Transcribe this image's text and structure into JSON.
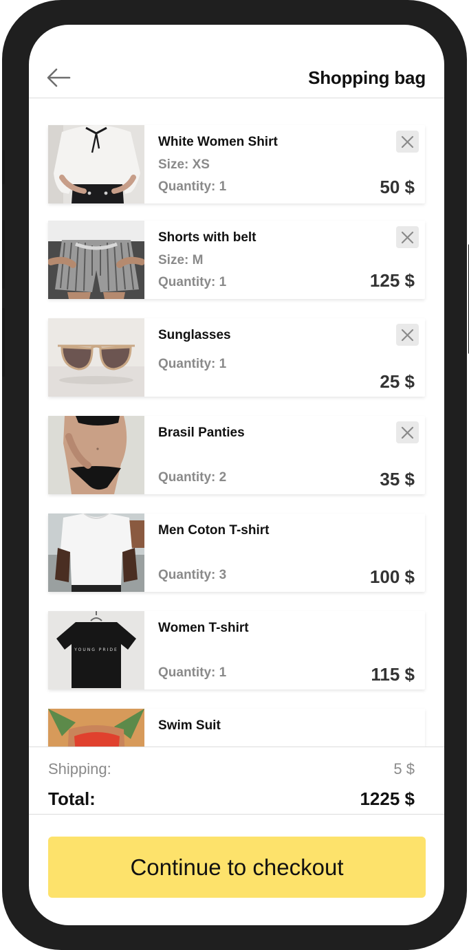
{
  "header": {
    "title": "Shopping bag",
    "back_icon": "arrow-left-icon"
  },
  "cart": {
    "items": [
      {
        "name": "White Women Shirt",
        "size": "Size: XS",
        "quantity": "Quantity: 1",
        "price": "50 $",
        "removable": true,
        "image": "white-shirt-photo"
      },
      {
        "name": "Shorts with belt",
        "size": "Size: M",
        "quantity": "Quantity: 1",
        "price": "125 $",
        "removable": true,
        "image": "striped-shorts-photo"
      },
      {
        "name": "Sunglasses",
        "size": "",
        "quantity": "Quantity: 1",
        "price": "25 $",
        "removable": true,
        "image": "sunglasses-photo"
      },
      {
        "name": "Brasil Panties",
        "size": "",
        "quantity": "Quantity: 2",
        "price": "35 $",
        "removable": true,
        "image": "panties-photo"
      },
      {
        "name": "Men Coton T-shirt",
        "size": "",
        "quantity": "Quantity: 3",
        "price": "100 $",
        "removable": false,
        "image": "white-tshirt-photo"
      },
      {
        "name": "Women T-shirt",
        "size": "",
        "quantity": "Quantity: 1",
        "price": "115 $",
        "removable": false,
        "image": "black-tshirt-photo"
      },
      {
        "name": "Swim Suit",
        "size": "",
        "quantity": "",
        "price": "",
        "removable": false,
        "image": "swimsuit-photo"
      }
    ]
  },
  "summary": {
    "shipping_label": "Shipping:",
    "shipping_value": "5 $",
    "total_label": "Total:",
    "total_value": "1225 $"
  },
  "checkout": {
    "label": "Continue to checkout",
    "color": "#fde26b"
  }
}
